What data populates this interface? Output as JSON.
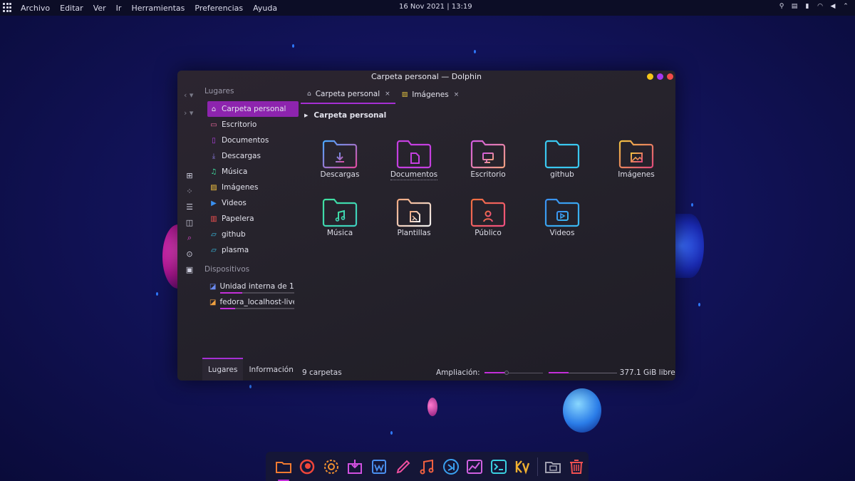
{
  "topbar": {
    "menu": [
      "Archivo",
      "Editar",
      "Ver",
      "Ir",
      "Herramientas",
      "Preferencias",
      "Ayuda"
    ],
    "clock": "16 Nov 2021 | 13:19"
  },
  "window": {
    "title": "Carpeta personal — Dolphin",
    "buttons": {
      "minimize": "#f5c518",
      "maximize": "#a637f2",
      "close": "#f24a4a"
    }
  },
  "sidebar": {
    "places_title": "Lugares",
    "places": [
      {
        "label": "Carpeta personal",
        "icon": "home-icon",
        "active": true
      },
      {
        "label": "Escritorio",
        "icon": "desktop-icon"
      },
      {
        "label": "Documentos",
        "icon": "documents-icon"
      },
      {
        "label": "Descargas",
        "icon": "download-icon"
      },
      {
        "label": "Música",
        "icon": "music-icon"
      },
      {
        "label": "Imágenes",
        "icon": "images-icon"
      },
      {
        "label": "Videos",
        "icon": "video-icon"
      },
      {
        "label": "Papelera",
        "icon": "trash-icon"
      },
      {
        "label": "github",
        "icon": "folder-icon"
      },
      {
        "label": "plasma",
        "icon": "folder-icon"
      }
    ],
    "devices_title": "Dispositivos",
    "devices": [
      {
        "label": "Unidad interna de 1…",
        "icon": "drive-icon",
        "usage": 0.3
      },
      {
        "label": "fedora_localhost-live",
        "icon": "drive-icon",
        "usage": 0.2
      }
    ],
    "bottom_tabs": [
      "Lugares",
      "Información"
    ]
  },
  "tabs": [
    {
      "label": "Carpeta personal",
      "icon": "home-icon",
      "active": true
    },
    {
      "label": "Imágenes",
      "icon": "images-icon",
      "active": false
    }
  ],
  "breadcrumb": "Carpeta personal",
  "folders": [
    {
      "label": "Descargas",
      "glyph": "download",
      "color": "#4aa8ff",
      "color2": "#e04aa0"
    },
    {
      "label": "Documentos",
      "glyph": "document",
      "color": "#c53fe0",
      "color2": "#c53fe0",
      "selected": true
    },
    {
      "label": "Escritorio",
      "glyph": "desktop",
      "color": "#d35ae0",
      "color2": "#f0a080"
    },
    {
      "label": "github",
      "glyph": "none",
      "color": "#3ac8f0",
      "color2": "#3ac8f0"
    },
    {
      "label": "Imágenes",
      "glyph": "image",
      "color": "#f0c040",
      "color2": "#e04a7a"
    },
    {
      "label": "Música",
      "glyph": "music",
      "color": "#3fe0a0",
      "color2": "#3fd0c0"
    },
    {
      "label": "Plantillas",
      "glyph": "template",
      "color": "#f0a880",
      "color2": "#f0f0f0"
    },
    {
      "label": "Público",
      "glyph": "user",
      "color": "#f07040",
      "color2": "#f05080"
    },
    {
      "label": "Videos",
      "glyph": "video",
      "color": "#3a90f0",
      "color2": "#3ab8f0"
    }
  ],
  "status": {
    "count": "9 carpetas",
    "zoom_label": "Ampliación:",
    "zoom_level": 0.38,
    "free_space": "377.1 GiB libre",
    "used_fraction": 0.3
  },
  "dock": [
    {
      "name": "dock-files",
      "icon": "folder-icon",
      "color": "#f07a30",
      "running": true
    },
    {
      "name": "dock-firefox",
      "icon": "firefox-icon",
      "color": "#f0463a"
    },
    {
      "name": "dock-settings",
      "icon": "gear-icon",
      "color": "#f09030"
    },
    {
      "name": "dock-discover",
      "icon": "software-icon",
      "color": "#d050e0"
    },
    {
      "name": "dock-writer",
      "icon": "writer-icon",
      "color": "#4a90f0"
    },
    {
      "name": "dock-draw",
      "icon": "draw-icon",
      "color": "#f050a0"
    },
    {
      "name": "dock-music",
      "icon": "music-icon",
      "color": "#f06040"
    },
    {
      "name": "dock-vscode",
      "icon": "vscode-icon",
      "color": "#3aa0f0"
    },
    {
      "name": "dock-monitor",
      "icon": "chart-icon",
      "color": "#d060e0"
    },
    {
      "name": "dock-terminal",
      "icon": "terminal-icon",
      "color": "#3ad0e0"
    },
    {
      "name": "dock-kvantum",
      "icon": "kvantum-icon",
      "color": "#f0b030"
    },
    {
      "name": "dock-desktop",
      "icon": "desktop-folder-icon",
      "color": "#a0a0b0"
    },
    {
      "name": "dock-trash",
      "icon": "trash-icon",
      "color": "#f05050"
    }
  ]
}
